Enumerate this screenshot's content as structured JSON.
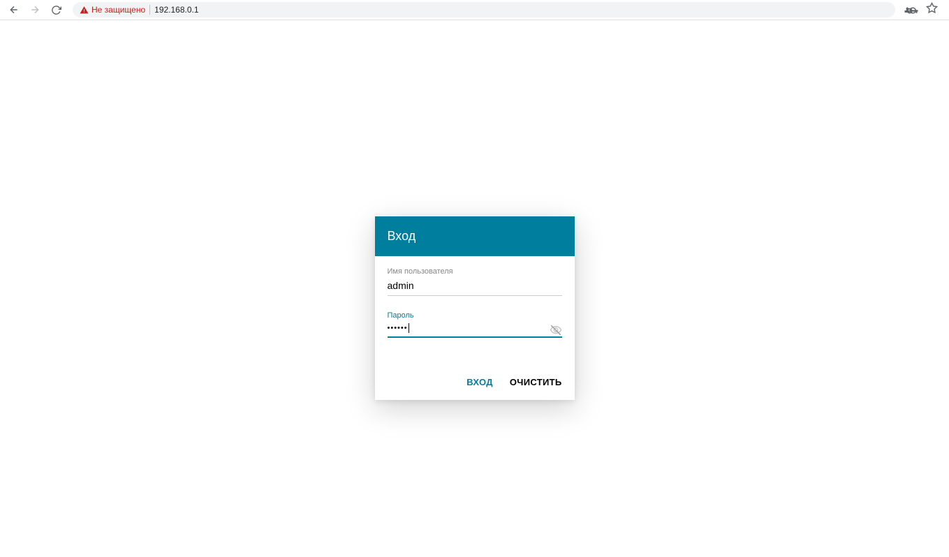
{
  "browser": {
    "not_secure_label": "Не защищено",
    "url": "192.168.0.1"
  },
  "login": {
    "title": "Вход",
    "username_label": "Имя пользователя",
    "username_value": "admin",
    "password_label": "Пароль",
    "password_value": "••••••",
    "submit_label": "ВХОД",
    "clear_label": "ОЧИСТИТЬ"
  }
}
